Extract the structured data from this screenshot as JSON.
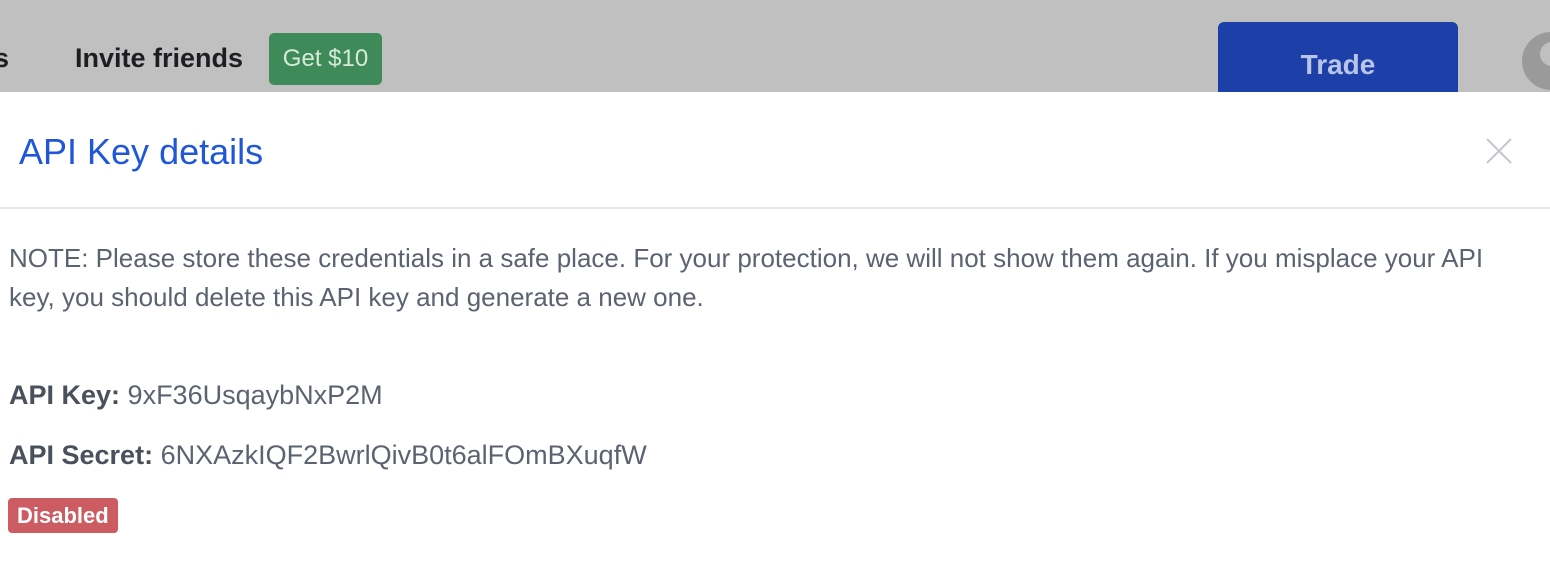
{
  "nav": {
    "partial_item": "s",
    "invite_label": "Invite friends",
    "promo_label": "Get $10",
    "trade_label": "Trade"
  },
  "modal": {
    "title": "API Key details",
    "note": "NOTE: Please store these credentials in a safe place. For your protection, we will not show them again. If you misplace your API key, you should delete this API key and generate a new one.",
    "api_key_label": "API Key:",
    "api_key_value": "9xF36UsqaybNxP2M",
    "api_secret_label": "API Secret:",
    "api_secret_value": "6NXAzkIQF2BwrlQivB0t6alFOmBXuqfW",
    "status": "Disabled"
  },
  "icons": {
    "close": "close-icon",
    "avatar": "user-avatar-icon"
  },
  "colors": {
    "accent": "#1f57d8",
    "trade_button": "#1c3fa8",
    "promo_badge": "#3e8a58",
    "status_disabled": "#cc5c62",
    "overlay": "#c0c0c0"
  }
}
